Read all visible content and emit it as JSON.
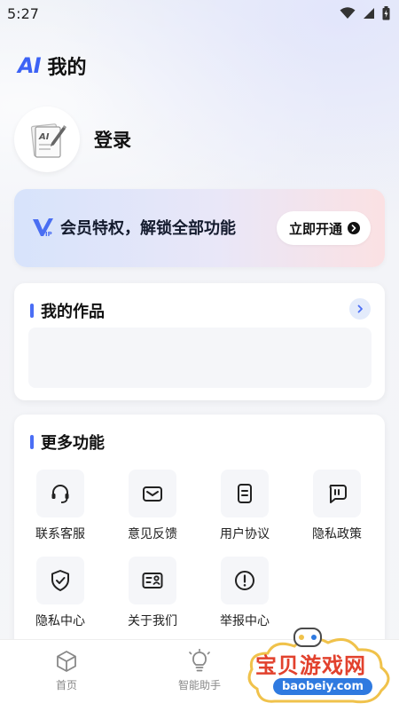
{
  "status_bar": {
    "time": "5:27"
  },
  "header": {
    "logo": "AI",
    "title": "我的"
  },
  "profile": {
    "login_label": "登录"
  },
  "vip": {
    "text": "会员特权，解锁全部功能",
    "button_label": "立即开通"
  },
  "works": {
    "title": "我的作品"
  },
  "more": {
    "title": "更多功能",
    "items": [
      {
        "label": "联系客服",
        "icon": "headset-icon"
      },
      {
        "label": "意见反馈",
        "icon": "mail-icon"
      },
      {
        "label": "用户协议",
        "icon": "document-icon"
      },
      {
        "label": "隐私政策",
        "icon": "policy-icon"
      },
      {
        "label": "隐私中心",
        "icon": "shield-check-icon"
      },
      {
        "label": "关于我们",
        "icon": "id-card-icon"
      },
      {
        "label": "举报中心",
        "icon": "alert-icon"
      }
    ]
  },
  "nav": {
    "items": [
      {
        "label": "首页",
        "icon": "cube-icon"
      },
      {
        "label": "智能助手",
        "icon": "lightbulb-icon"
      }
    ]
  },
  "watermark": {
    "text": "宝贝游戏网",
    "url": "baobeiy.com"
  },
  "colors": {
    "accent": "#4b6ef5",
    "watermark_red": "#e2412d",
    "watermark_blue": "#2f7ae0"
  }
}
